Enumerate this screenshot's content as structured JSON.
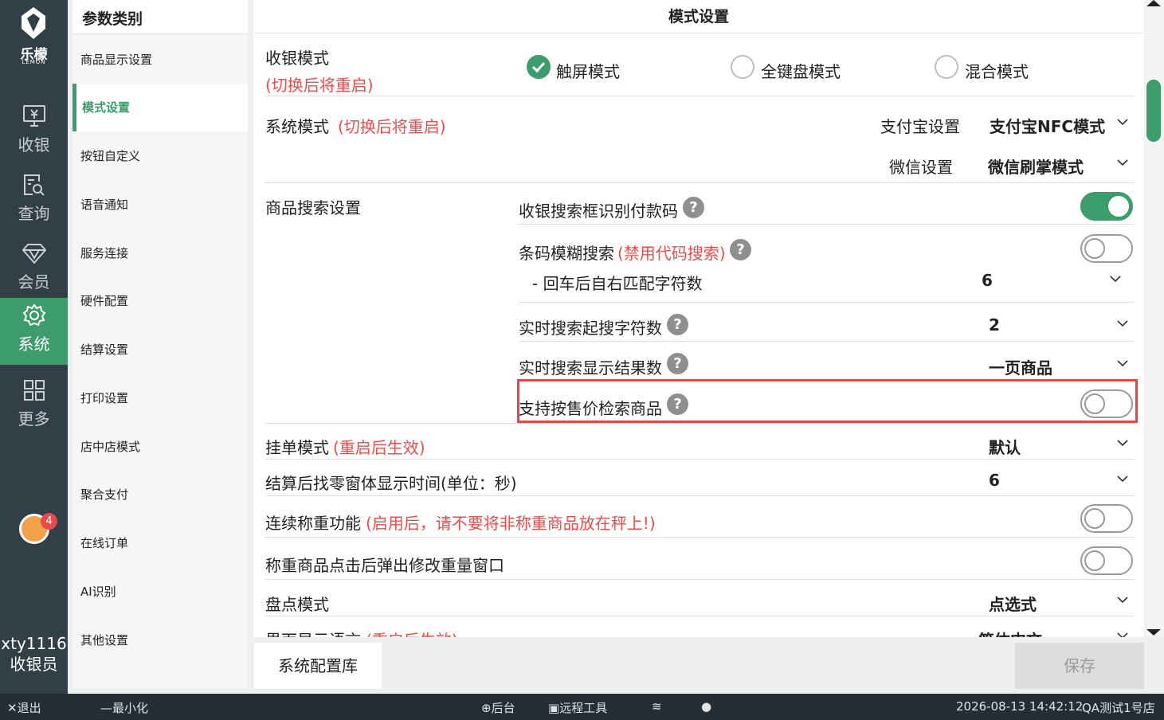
{
  "brand": {
    "name": "乐檬",
    "sub": "LEMON"
  },
  "rail": {
    "items": [
      {
        "label": "收银",
        "icon": "cash-register-icon"
      },
      {
        "label": "查询",
        "icon": "search-doc-icon"
      },
      {
        "label": "会员",
        "icon": "diamond-icon"
      },
      {
        "label": "系统",
        "icon": "gear-icon"
      },
      {
        "label": "更多",
        "icon": "grid-icon"
      }
    ],
    "notifications": "4",
    "user": {
      "id": "xty1116",
      "role": "收银员"
    }
  },
  "categories": {
    "header": "参数类别",
    "items": [
      "商品显示设置",
      "模式设置",
      "按钮自定义",
      "语音通知",
      "服务连接",
      "硬件配置",
      "结算设置",
      "打印设置",
      "店中店模式",
      "聚合支付",
      "在线订单",
      "AI识别",
      "其他设置"
    ]
  },
  "main": {
    "title": "模式设置",
    "cashier_mode": {
      "label": "收银模式",
      "note": "(切换后将重启)",
      "options": [
        "触屏模式",
        "全键盘模式",
        "混合模式"
      ],
      "selected": "触屏模式"
    },
    "system_mode": {
      "label": "系统模式",
      "note": "(切换后将重启)",
      "alipay_label": "支付宝设置",
      "alipay_value": "支付宝NFC模式",
      "wechat_label": "微信设置",
      "wechat_value": "微信刷掌模式"
    },
    "search": {
      "label": "商品搜索设置",
      "recognize_pay_code": {
        "label": "收银搜索框识别付款码",
        "on": true
      },
      "barcode_fuzzy": {
        "label": "条码模糊搜索",
        "note": "(禁用代码搜索)",
        "on": false
      },
      "enter_match": {
        "label": "- 回车后自右匹配字符数",
        "value": "6"
      },
      "realtime_min": {
        "label": "实时搜索起搜字符数",
        "value": "2"
      },
      "realtime_results": {
        "label": "实时搜索显示结果数",
        "value": "一页商品"
      },
      "search_by_price": {
        "label": "支持按售价检索商品",
        "on": false
      }
    },
    "hold_order": {
      "label": "挂单模式",
      "note": "(重启后生效)",
      "value": "默认"
    },
    "change_window": {
      "label": "结算后找零窗体显示时间(单位：秒)",
      "value": "6"
    },
    "continuous_weigh": {
      "label": "连续称重功能",
      "note": "(启用后，请不要将非称重商品放在秤上!)",
      "on": false
    },
    "weigh_popup": {
      "label": "称重商品点击后弹出修改重量窗口",
      "on": false
    },
    "inventory_mode": {
      "label": "盘点模式",
      "value": "点选式"
    },
    "ui_language": {
      "label": "界面显示语言",
      "note": "(重启后生效)",
      "value": "简体中文"
    }
  },
  "actions": {
    "config_library": "系统配置库",
    "save": "保存"
  },
  "statusbar": {
    "exit": "退出",
    "minimize": "最小化",
    "backend": "后台",
    "remote": "远程工具",
    "datetime": "2026-08-13 14:42:12",
    "store": "QA测试1号店"
  },
  "colors": {
    "accent": "#3d9c6b",
    "rail": "#323f47",
    "warn": "#ee4c4c"
  }
}
